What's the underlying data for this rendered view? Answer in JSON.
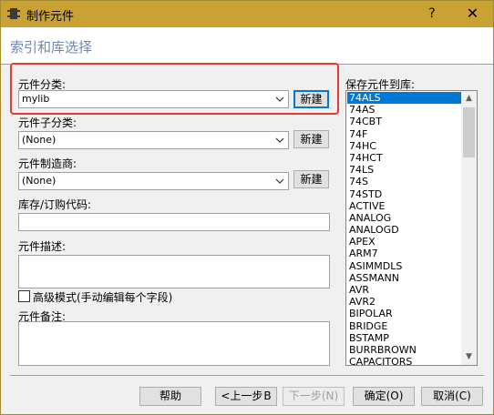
{
  "titlebar": {
    "title": "制作元件",
    "help": "?",
    "close": "✕"
  },
  "header": {
    "heading": "索引和库选择"
  },
  "category": {
    "label": "元件分类:",
    "value": "mylib",
    "new_label": "新建"
  },
  "subcategory": {
    "label": "元件子分类:",
    "value": "(None)",
    "new_label": "新建"
  },
  "manufacturer": {
    "label": "元件制造商:",
    "value": "(None)",
    "new_label": "新建"
  },
  "stock_code": {
    "label": "库存/订购代码:",
    "value": ""
  },
  "description": {
    "label": "元件描述:",
    "value": ""
  },
  "advanced_mode": {
    "label": "高级模式(手动编辑每个字段)",
    "checked": false
  },
  "notes": {
    "label": "元件备注:",
    "value": ""
  },
  "library": {
    "label": "保存元件到库:",
    "items": [
      "74ALS",
      "74AS",
      "74CBT",
      "74F",
      "74HC",
      "74HCT",
      "74LS",
      "74S",
      "74STD",
      "ACTIVE",
      "ANALOG",
      "ANALOGD",
      "APEX",
      "ARM7",
      "ASIMMDLS",
      "ASSMANN",
      "AVR",
      "AVR2",
      "BIPOLAR",
      "BRIDGE",
      "BSTAMP",
      "BURRBROWN",
      "CAPACITORS"
    ],
    "selected": "74ALS"
  },
  "footer": {
    "help_label": "帮助",
    "back_label": "<上一步",
    "back_mnemonic": "B",
    "next_label": "下一步(N)",
    "ok_label": "确定(O)",
    "cancel_label": "取消(C)"
  }
}
